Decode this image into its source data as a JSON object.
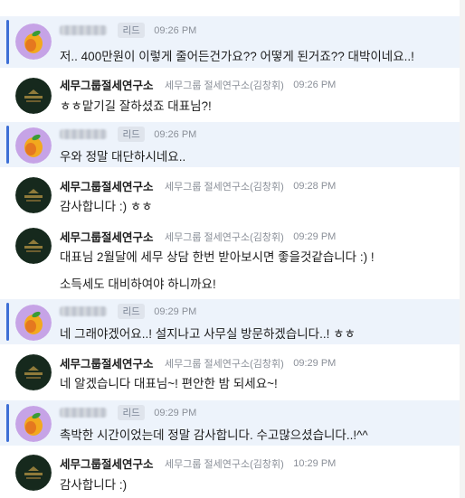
{
  "messages": [
    {
      "kind": "customer",
      "tag": "리드",
      "time": "09:26 PM",
      "text": "저.. 400만원이 이렇게 줄어든건가요?? 어떻게 된거죠?? 대박이네요..!"
    },
    {
      "kind": "agent",
      "name": "세무그룹절세연구소",
      "sub": "세무그룹 절세연구소(김창휘)",
      "time": "09:26 PM",
      "text": "ㅎㅎ맡기길 잘하셨죠 대표님?!"
    },
    {
      "kind": "customer",
      "tag": "리드",
      "time": "09:26 PM",
      "text": "우와 정말 대단하시네요.."
    },
    {
      "kind": "agent",
      "name": "세무그룹절세연구소",
      "sub": "세무그룹 절세연구소(김창휘)",
      "time": "09:28 PM",
      "text": "감사합니다 :) ㅎㅎ"
    },
    {
      "kind": "agent",
      "name": "세무그룹절세연구소",
      "sub": "세무그룹 절세연구소(김창휘)",
      "time": "09:29 PM",
      "text": "대표님 2월달에 세무 상담 한번 받아보시면 좋을것같습니다 :) !",
      "text2": "소득세도 대비하여야 하니까요!"
    },
    {
      "kind": "customer",
      "tag": "리드",
      "time": "09:29 PM",
      "text": "네 그래야겠어요..! 설지나고 사무실 방문하겠습니다..! ㅎㅎ"
    },
    {
      "kind": "agent",
      "name": "세무그룹절세연구소",
      "sub": "세무그룹 절세연구소(김창휘)",
      "time": "09:29 PM",
      "text": "네 알겠습니다 대표님~! 편안한 밤 되세요~!"
    },
    {
      "kind": "customer",
      "tag": "리드",
      "time": "09:29 PM",
      "text": "촉박한 시간이었는데 정말 감사합니다. 수고많으셨습니다..!^^"
    },
    {
      "kind": "agent",
      "name": "세무그룹절세연구소",
      "sub": "세무그룹 절세연구소(김창휘)",
      "time": "10:29 PM",
      "text": "감사합니다 :)"
    }
  ],
  "colors": {
    "customer_bg": "#edf3fb",
    "accent": "#3d6fd6",
    "avatar_agent": "#16291d",
    "avatar_customer": "#c6a3e6"
  },
  "icons": {
    "customer_avatar": "mango-icon",
    "agent_avatar": "company-logo-icon"
  }
}
